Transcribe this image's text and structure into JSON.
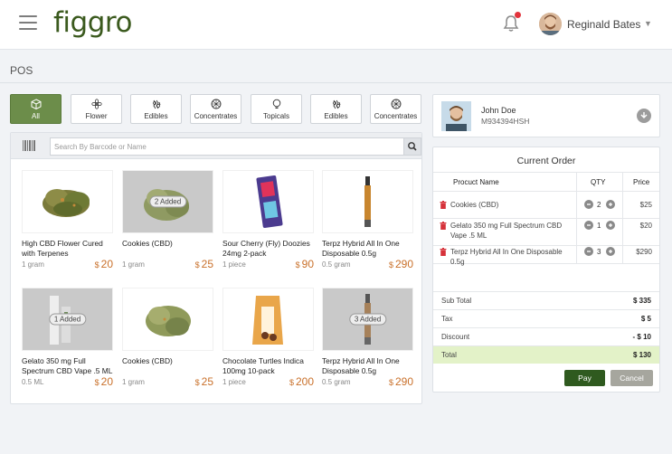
{
  "header": {
    "logo_text": "figgro",
    "user_name": "Reginald Bates",
    "caret": "▼"
  },
  "page_title": "POS",
  "categories": [
    {
      "label": "All",
      "icon": "box-icon",
      "active": true
    },
    {
      "label": "Flower",
      "icon": "flower-icon",
      "active": false
    },
    {
      "label": "Edibles",
      "icon": "edibles-icon",
      "active": false
    },
    {
      "label": "Concentrates",
      "icon": "concentrates-icon",
      "active": false
    },
    {
      "label": "Topicals",
      "icon": "topicals-icon",
      "active": false
    },
    {
      "label": "Edibles",
      "icon": "edibles-icon",
      "active": false
    },
    {
      "label": "Concentrates",
      "icon": "concentrates-icon",
      "active": false
    }
  ],
  "search": {
    "placeholder": "Search By Barcode or Name"
  },
  "currency_symbol": "$",
  "products": [
    {
      "name": "High CBD Flower Cured with Terpenes",
      "unit": "1 gram",
      "price": "20",
      "badge": ""
    },
    {
      "name": "Cookies (CBD)",
      "unit": "1 gram",
      "price": "25",
      "badge": "2 Added"
    },
    {
      "name": "Sour Cherry (Fly) Doozies 24mg 2-pack",
      "unit": "1 piece",
      "price": "90",
      "badge": ""
    },
    {
      "name": "Terpz Hybrid All In One Disposable 0.5g",
      "unit": "0.5 gram",
      "price": "290",
      "badge": ""
    },
    {
      "name": "Gelato 350 mg Full Spectrum CBD Vape .5 ML",
      "unit": "0.5 ML",
      "price": "20",
      "badge": "1 Added"
    },
    {
      "name": "Cookies (CBD)",
      "unit": "1 gram",
      "price": "25",
      "badge": ""
    },
    {
      "name": "Chocolate Turtles Indica 100mg 10-pack",
      "unit": "1 piece",
      "price": "200",
      "badge": ""
    },
    {
      "name": "Terpz Hybrid All In One Disposable 0.5g",
      "unit": "0.5 gram",
      "price": "290",
      "badge": "3 Added"
    }
  ],
  "customer": {
    "name": "John Doe",
    "id": "M934394HSH"
  },
  "order": {
    "title": "Current Order",
    "col_name": "Procuct Name",
    "col_qty": "QTY",
    "col_price": "Price",
    "items": [
      {
        "name": "Cookies (CBD)",
        "qty": "2",
        "price": "$25"
      },
      {
        "name": "Gelato 350 mg Full  Spectrum CBD Vape .5 ML",
        "qty": "1",
        "price": "$20"
      },
      {
        "name": "Terpz Hybrid All In One Disposable 0.5g",
        "qty": "3",
        "price": "$290"
      }
    ],
    "summary": {
      "subtotal_label": "Sub Total",
      "subtotal": "$ 335",
      "tax_label": "Tax",
      "tax": "$ 5",
      "discount_label": "Discount",
      "discount": "- $ 10",
      "total_label": "Total",
      "total": "$ 130"
    },
    "pay_label": "Pay",
    "cancel_label": "Cancel"
  },
  "colors": {
    "brand": "#3b5a1e",
    "active_category": "#6c8d4a",
    "price": "#c9702a",
    "pay": "#2f5a1f",
    "cancel": "#a6a69e",
    "total_row": "#e3f2c8"
  }
}
